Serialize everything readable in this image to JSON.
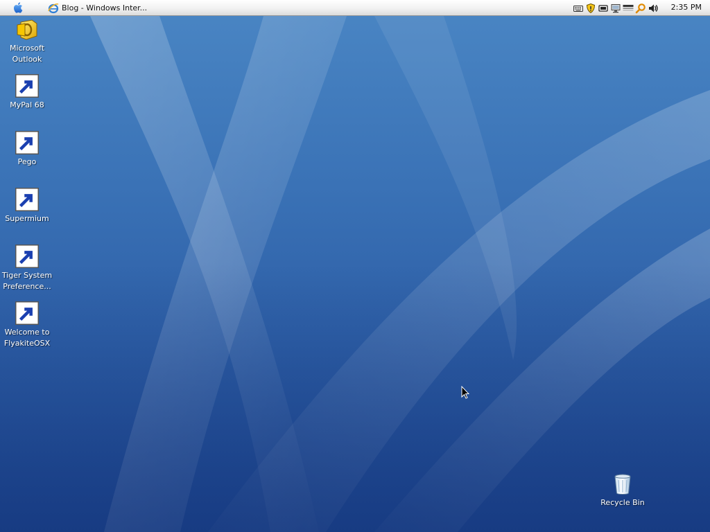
{
  "menubar": {
    "apple_icon": "apple-icon",
    "active_window": {
      "icon": "internet-explorer-icon",
      "title": "Blog - Windows Inter..."
    },
    "tray_icons": [
      "keyboard-icon",
      "security-shield-icon",
      "battery-icon",
      "network-icon",
      "display-icon",
      "search-icon",
      "volume-icon"
    ],
    "clock": "2:35 PM"
  },
  "desktop": {
    "icons": [
      {
        "name": "Microsoft\nOutlook",
        "icon": "outlook-icon"
      },
      {
        "name": "MyPal 68",
        "icon": "mypal-icon"
      },
      {
        "name": "Pego",
        "icon": "pego-icon"
      },
      {
        "name": "Supermium",
        "icon": "supermium-icon"
      },
      {
        "name": "Tiger System\nPreference...",
        "icon": "system-preferences-icon"
      },
      {
        "name": "Welcome to\nFlyakiteOSX",
        "icon": "document-icon"
      }
    ],
    "recycle_bin": {
      "name": "Recycle Bin",
      "icon": "recycle-bin-icon"
    }
  },
  "colors": {
    "wallpaper_top": "#4a86c4",
    "wallpaper_bottom": "#1e4590",
    "menubar": "#f1f1f1",
    "desktop_label": "#ffffff"
  }
}
